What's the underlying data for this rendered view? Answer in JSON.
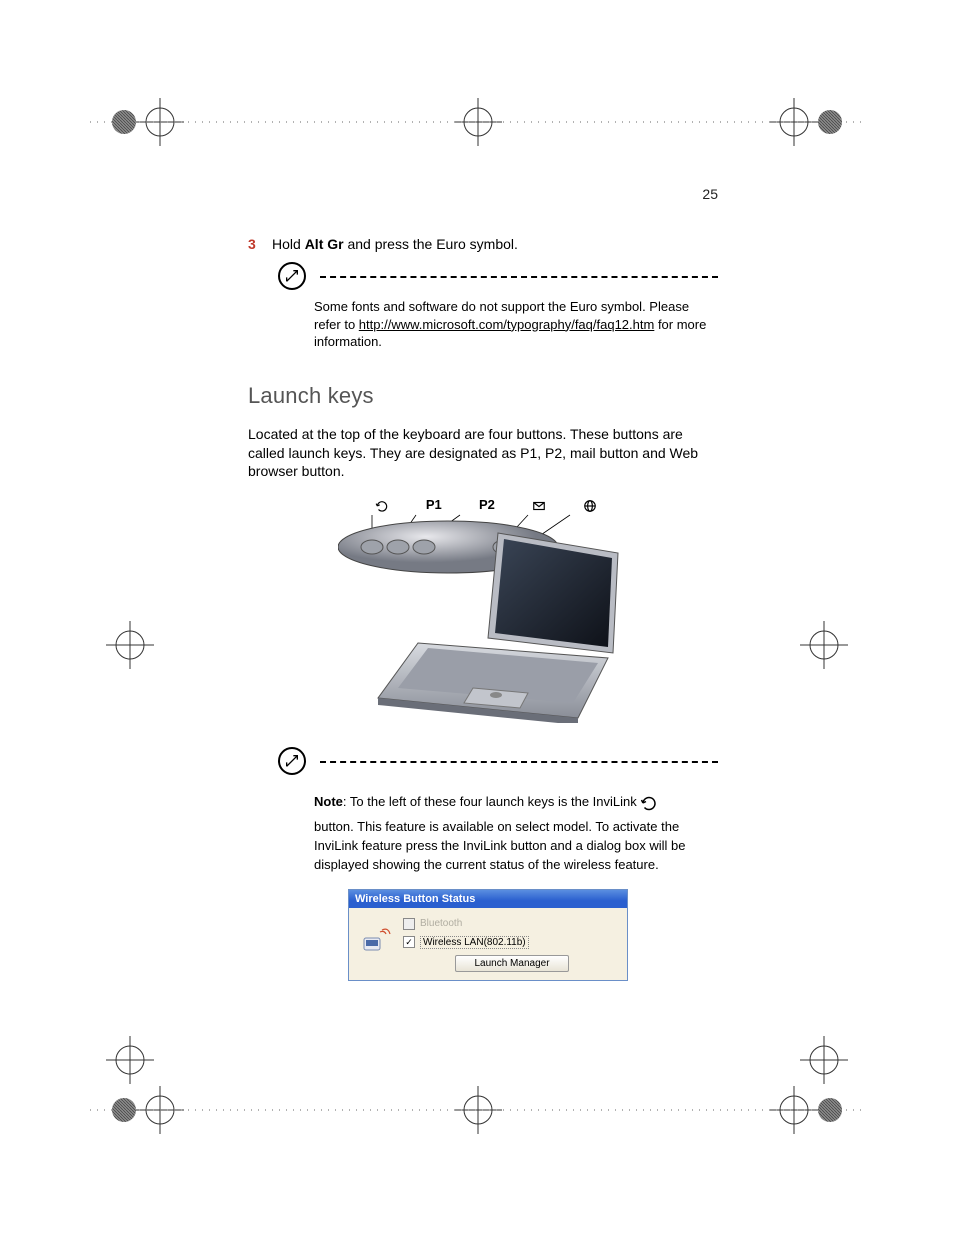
{
  "page_number": "25",
  "step": {
    "number": "3",
    "prefix": "Hold ",
    "bold": "Alt Gr",
    "suffix": " and press the Euro symbol."
  },
  "note1": {
    "text_before_link": "Some fonts and software do not support the Euro symbol. Please refer to  ",
    "link": "http://www.microsoft.com/typography/faq/faq12.htm",
    "text_after_link": " for more information."
  },
  "heading": "Launch keys",
  "paragraph": "Located at the top of the keyboard are four buttons.  These buttons are called launch keys.  They are designated as P1, P2, mail button and Web browser button.",
  "launch_key_labels": {
    "invilink": "⟳",
    "p1": "P1",
    "p2": "P2",
    "mail": "✉",
    "web": "🌐"
  },
  "note2": {
    "bold": "Note",
    "line1_after_bold": ": To the left of these four launch keys is the InviLink ",
    "line2": "button.  This feature is available on select model.  To activate the InviLink feature press the InviLink button and a dialog box will be displayed showing the current status of the wireless feature."
  },
  "dialog": {
    "title": "Wireless Button Status",
    "option_bluetooth": "Bluetooth",
    "option_wlan": "Wireless LAN(802.11b)",
    "button": "Launch Manager"
  }
}
